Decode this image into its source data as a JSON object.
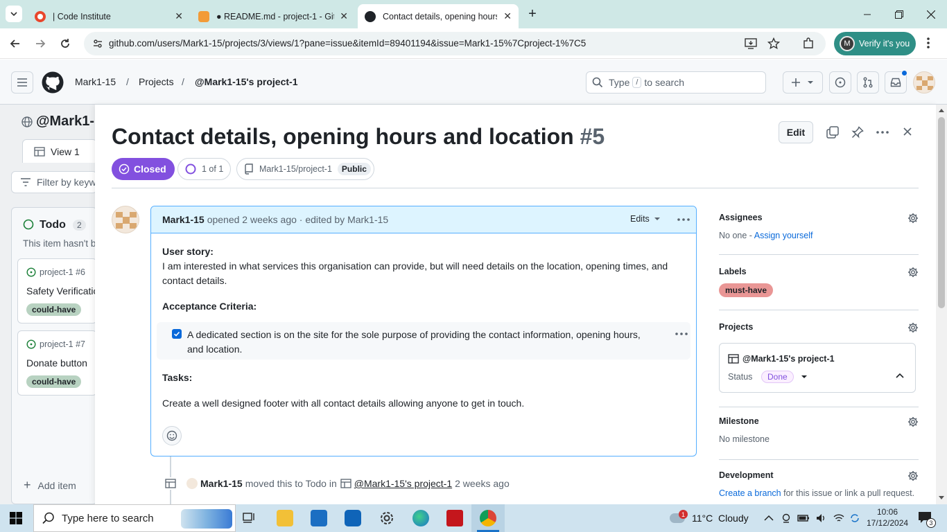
{
  "browser": {
    "tabs": [
      {
        "label": "| Code Institute"
      },
      {
        "label": "● README.md - project-1 - Gitp"
      },
      {
        "label": "Contact details, opening hours"
      }
    ],
    "url": "github.com/users/Mark1-15/projects/3/views/1?pane=issue&itemId=89401194&issue=Mark1-15%7Cproject-1%7C5",
    "verify_label": "Verify it's you",
    "verify_avatar": "M"
  },
  "github": {
    "breadcrumbs": [
      "Mark1-15",
      "/",
      "Projects",
      "/",
      "@Mark1-15's project-1"
    ],
    "search_prefix": "Type",
    "search_key": "/",
    "search_suffix": "to search"
  },
  "board": {
    "project_title": "@Mark1-1",
    "view_tab": "View 1",
    "filter_placeholder": "Filter by keyw",
    "column": {
      "name": "Todo",
      "count": "2",
      "hint": "This item hasn't b"
    },
    "cards": [
      {
        "ref": "project-1 #6",
        "title": "Safety Verificatio",
        "label": "could-have"
      },
      {
        "ref": "project-1 #7",
        "title": "Donate button",
        "label": "could-have"
      }
    ],
    "add_item": "Add item"
  },
  "issue": {
    "title": "Contact details, opening hours and location",
    "number": "#5",
    "edit_label": "Edit",
    "state": "Closed",
    "subissues": "1 of 1",
    "repo": "Mark1-15/project-1",
    "visibility": "Public",
    "comment": {
      "author": "Mark1-15",
      "meta": "opened 2 weeks ago · edited by Mark1-15",
      "edits_label": "Edits",
      "story_heading": "User story:",
      "story_text": "I am interested in what services this organisation can provide, but will need details on the location, opening times, and contact details.",
      "criteria_heading": "Acceptance Criteria:",
      "criteria_item": "A dedicated section is on the site for the sole purpose of providing the contact information, opening hours, and location.",
      "criteria_checked": true,
      "tasks_heading": "Tasks:",
      "tasks_text": "Create a well designed footer with all contact details allowing anyone to get in touch."
    },
    "event": {
      "actor": "Mark1-15",
      "action": "moved this to Todo in",
      "project": "@Mark1-15's project-1",
      "time": "2 weeks ago"
    }
  },
  "sidebar": {
    "assignees": {
      "heading": "Assignees",
      "value": "No one - ",
      "link": "Assign yourself"
    },
    "labels": {
      "heading": "Labels",
      "label": "must-have",
      "label_color": "#e99695"
    },
    "projects": {
      "heading": "Projects",
      "project": "@Mark1-15's project-1",
      "status_label": "Status",
      "status_value": "Done"
    },
    "milestone": {
      "heading": "Milestone",
      "value": "No milestone"
    },
    "development": {
      "heading": "Development",
      "link": "Create a branch",
      "rest": " for this issue or link a pull request."
    }
  },
  "taskbar": {
    "search_placeholder": "Type here to search",
    "weather": "11°C  Cloudy",
    "weather_badge": "1",
    "time": "10:06",
    "date": "17/12/2024",
    "notifications": "3"
  },
  "colors": {
    "closed": "#8250df",
    "accent": "#0969da",
    "label_could_have": "#b8d2c1"
  }
}
